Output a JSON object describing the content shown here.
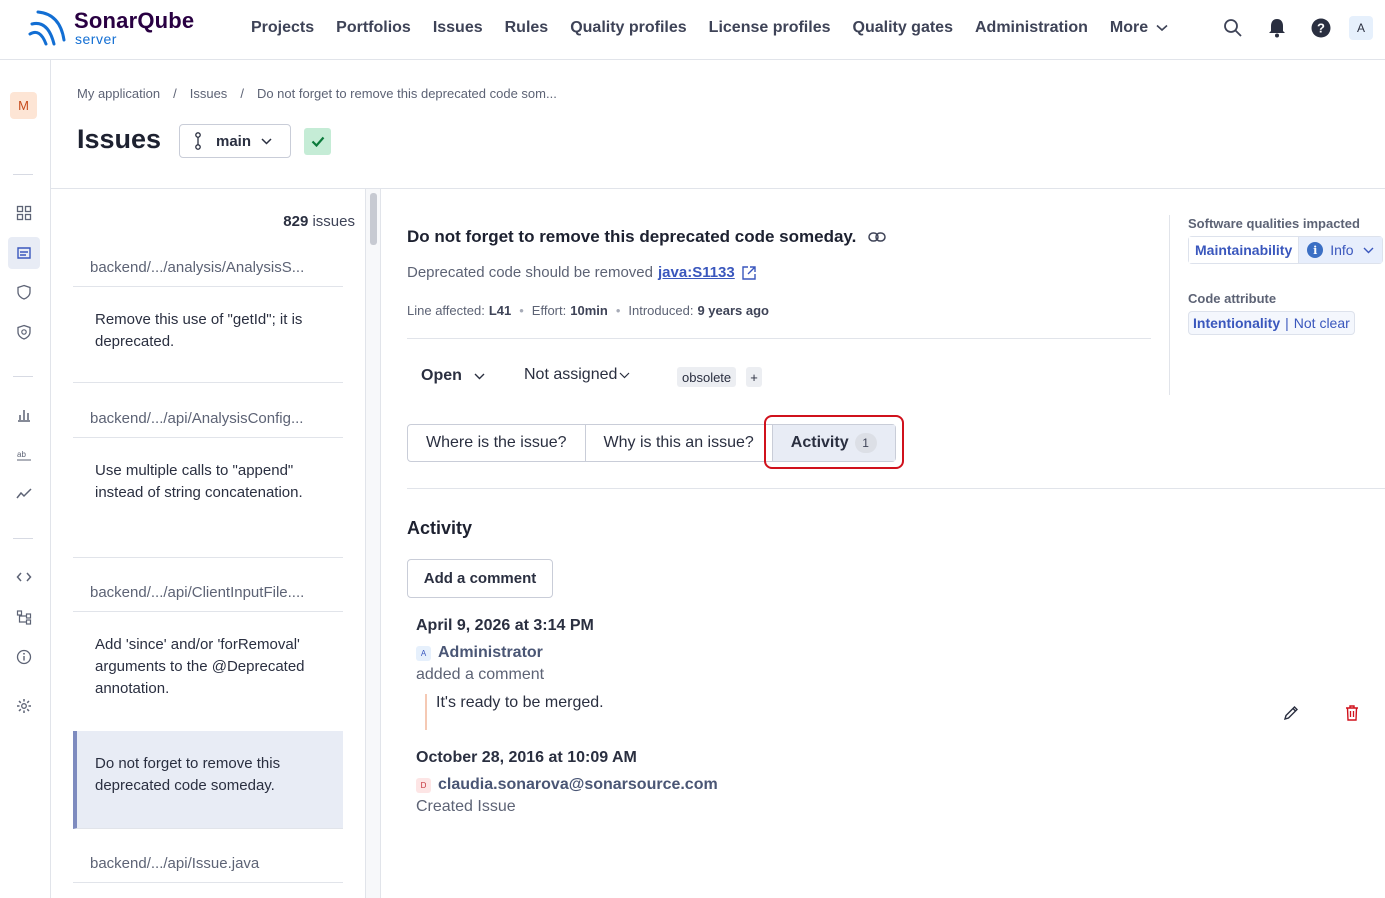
{
  "app": {
    "logo_name": "SonarQube",
    "logo_sub": "server"
  },
  "nav": {
    "items": [
      "Projects",
      "Portfolios",
      "Issues",
      "Rules",
      "Quality profiles",
      "License profiles",
      "Quality gates",
      "Administration"
    ],
    "more_label": "More",
    "user_initial": "A"
  },
  "rail": {
    "project_initial": "M"
  },
  "breadcrumb": [
    "My application",
    "Issues",
    "Do not forget to remove this deprecated code som..."
  ],
  "page": {
    "title": "Issues",
    "branch": "main"
  },
  "issue_list": {
    "count_number": "829",
    "count_label": "issues",
    "files": [
      "backend/.../analysis/AnalysisS...",
      "backend/.../api/AnalysisConfig...",
      "backend/.../api/ClientInputFile....",
      "backend/.../api/Issue.java"
    ],
    "issues": [
      "Remove this use of \"getId\"; it is deprecated.",
      "Use multiple calls to \"append\" instead of string concatenation.",
      "Add 'since' and/or 'forRemoval' arguments to the @Deprecated annotation.",
      "Do not forget to remove this deprecated code someday."
    ]
  },
  "issue": {
    "title": "Do not forget to remove this deprecated code someday.",
    "rule_text": "Deprecated code should be removed",
    "rule_key": "java:S1133",
    "line_label": "Line affected:",
    "line_value": "L41",
    "effort_label": "Effort:",
    "effort_value": "10min",
    "introduced_label": "Introduced:",
    "introduced_value": "9 years ago",
    "status": "Open",
    "assignee": "Not assigned",
    "tag": "obsolete",
    "tag_add": "+"
  },
  "tabs": [
    {
      "label": "Where is the issue?"
    },
    {
      "label": "Why is this an issue?"
    },
    {
      "label": "Activity",
      "count": "1"
    }
  ],
  "activity": {
    "title": "Activity",
    "add_comment": "Add a comment",
    "entries": [
      {
        "date": "April 9, 2026 at 3:14 PM",
        "user_initial": "A",
        "user": "Administrator",
        "action": "added a comment",
        "comment": "It's ready to be merged."
      },
      {
        "date": "October 28, 2016 at 10:09 AM",
        "user_initial": "D",
        "user": "claudia.sonarova@sonarsource.com",
        "action": "Created Issue"
      }
    ]
  },
  "side": {
    "qualities_label": "Software qualities impacted",
    "quality_name": "Maintainability",
    "severity_icon": "i",
    "severity": "Info",
    "attribute_label": "Code attribute",
    "attribute_main": "Intentionality",
    "attribute_bar": "|",
    "attribute_detail": "Not clear"
  },
  "colors": {
    "accent": "#3a57bd",
    "highlight": "#d0111c",
    "qg_ok": "#c5ecd6",
    "delete": "#d0111c"
  }
}
